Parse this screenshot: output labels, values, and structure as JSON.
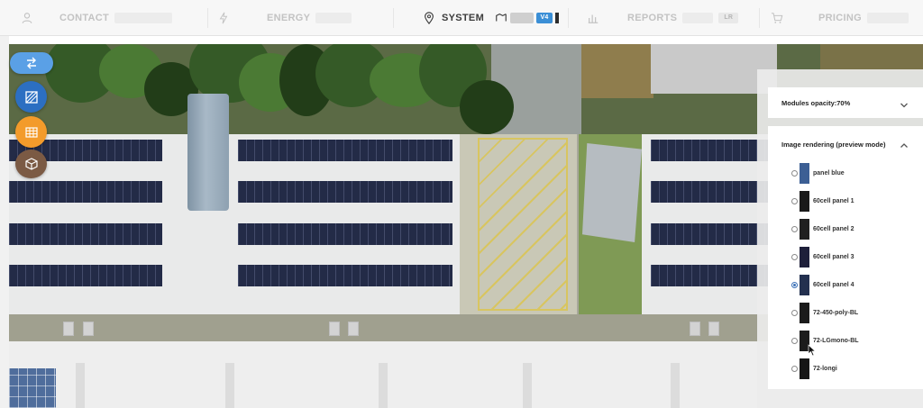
{
  "nav": {
    "contact": {
      "label": "CONTACT",
      "icon": "user-icon"
    },
    "energy": {
      "label": "ENERGY",
      "icon": "bolt-icon"
    },
    "system": {
      "label": "SYSTEM",
      "icon": "map-pin-icon",
      "toggle_on_label": "V4",
      "toggle_icon": "panels-icon"
    },
    "reports": {
      "label": "REPORTS",
      "icon": "bar-chart-icon",
      "badge": "LR"
    },
    "pricing": {
      "label": "PRICING",
      "icon": "cart-icon"
    },
    "active_color": "#3c3c3c",
    "inactive_color": "#c3c3c3"
  },
  "tools": [
    {
      "name": "layers-toggle-button",
      "icon": "swap-icon",
      "color": "#5aa0e6"
    },
    {
      "name": "hatch-tool-button",
      "icon": "hatch-icon",
      "color": "#2c6fc2"
    },
    {
      "name": "panel-grid-button",
      "icon": "grid-icon",
      "color": "#f39b2b"
    },
    {
      "name": "3d-box-button",
      "icon": "cube-icon",
      "color": "#7b5a44"
    }
  ],
  "panel": {
    "opacity_section": {
      "title": "Modules opacity:70%",
      "expanded": false,
      "opacity": 0.7
    },
    "rendering_section": {
      "title": "Image rendering (preview mode)",
      "expanded": true,
      "selected_index": 4,
      "options": [
        {
          "label": "panel blue",
          "swatch": "#3c5f94"
        },
        {
          "label": "60cell panel 1",
          "swatch": "#1a1a1a"
        },
        {
          "label": "60cell panel 2",
          "swatch": "#202020"
        },
        {
          "label": "60cell panel 3",
          "swatch": "#1e1f3a"
        },
        {
          "label": "60cell panel 4",
          "swatch": "#23304f"
        },
        {
          "label": "72-450-poly-BL",
          "swatch": "#1b1b1b"
        },
        {
          "label": "72-LGmono-BL",
          "swatch": "#1c1c1c"
        },
        {
          "label": "72-longi",
          "swatch": "#161616"
        }
      ]
    }
  },
  "colors": {
    "accent_blue": "#3b8fd6",
    "solar_panel": "#141c3a",
    "roof": "#e9eaea",
    "parking_lines": "#d8c560"
  }
}
